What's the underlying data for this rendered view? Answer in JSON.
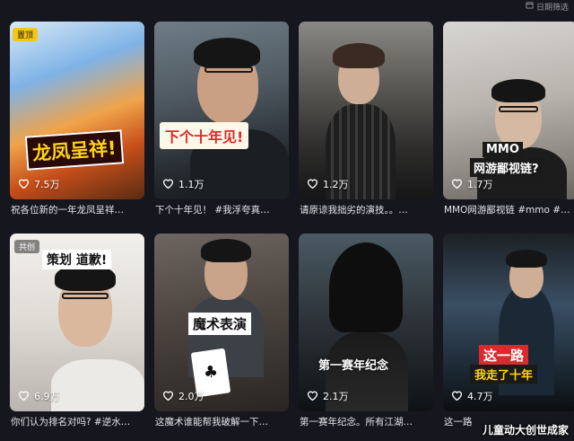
{
  "topbar": {
    "filter_label": "日期筛选"
  },
  "cards": [
    {
      "likes": "7.5万",
      "caption": "祝各位新的一年龙凤呈祥…",
      "badge": "置顶",
      "overlay": "龙凤呈祥!"
    },
    {
      "likes": "1.1万",
      "caption": "下个十年见！ #我浮夸真…",
      "overlay": "下个十年见!"
    },
    {
      "likes": "1.2万",
      "caption": "请原谅我拙劣的演技。。…"
    },
    {
      "likes": "1.7万",
      "caption": "MMO网游鄙视链 #mmo #…",
      "overlay": "MMO\n网游鄙视链?",
      "overlay_line1": "MMO",
      "overlay_line2": "网游鄙视链?"
    },
    {
      "likes": "6.9万",
      "caption": "你们认为排名对吗? #逆水…",
      "badge": "共创",
      "overlay": "策划 道歉!"
    },
    {
      "likes": "2.0万",
      "caption": "这魔术谁能帮我破解一下…",
      "overlay": "魔术表演"
    },
    {
      "likes": "2.1万",
      "caption": "第一赛年纪念。所有江湖…",
      "overlay": "第一赛年纪念"
    },
    {
      "likes": "4.7万",
      "caption": "这一路",
      "overlay_line1": "这一路",
      "overlay_line2": "我走了十年"
    }
  ],
  "watermark": "儿童动大创世成家",
  "colors": {
    "background": "#16161e",
    "pin_badge": "#f5c518",
    "overlay_red": "#d92b2b",
    "overlay_yellow": "#ffd21a"
  }
}
